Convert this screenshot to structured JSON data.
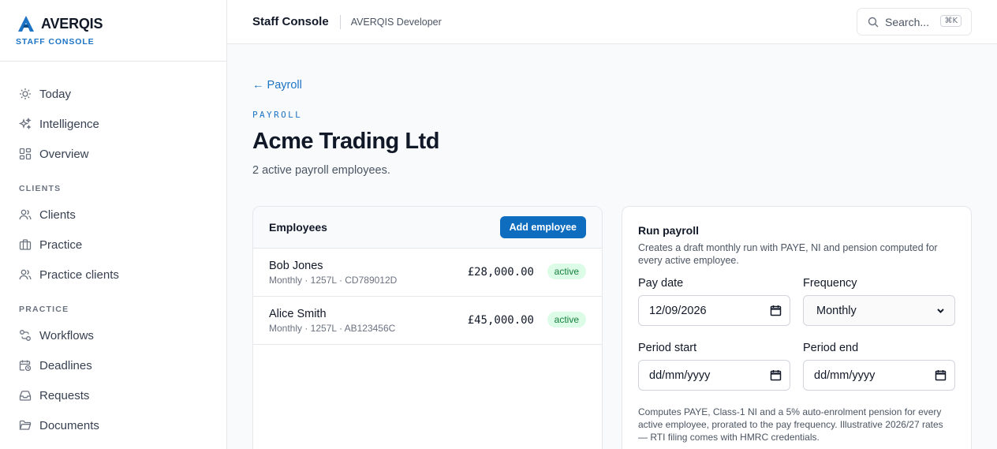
{
  "brand": {
    "name": "AVERQIS",
    "subtitle": "STAFF CONSOLE"
  },
  "sidebar": {
    "items_top": [
      {
        "label": "Today",
        "icon": "sun-icon"
      },
      {
        "label": "Intelligence",
        "icon": "sparkles-icon"
      },
      {
        "label": "Overview",
        "icon": "grid-icon"
      }
    ],
    "section_clients": "CLIENTS",
    "items_clients": [
      {
        "label": "Clients",
        "icon": "users-icon"
      },
      {
        "label": "Practice",
        "icon": "briefcase-icon"
      },
      {
        "label": "Practice clients",
        "icon": "users-icon"
      }
    ],
    "section_practice": "PRACTICE",
    "items_practice": [
      {
        "label": "Workflows",
        "icon": "workflow-icon"
      },
      {
        "label": "Deadlines",
        "icon": "calendar-clock-icon"
      },
      {
        "label": "Requests",
        "icon": "inbox-icon"
      },
      {
        "label": "Documents",
        "icon": "folder-icon"
      }
    ]
  },
  "topbar": {
    "title": "Staff Console",
    "subtitle": "AVERQIS Developer",
    "search_placeholder": "Search...",
    "search_shortcut": "⌘K"
  },
  "main": {
    "back_link": "← Payroll",
    "eyebrow": "PAYROLL",
    "title": "Acme Trading Ltd",
    "subtitle": "2 active payroll employees."
  },
  "employees": {
    "title": "Employees",
    "add_button": "Add employee",
    "rows": [
      {
        "name": "Bob Jones",
        "meta": "Monthly · 1257L · CD789012D",
        "salary": "£28,000.00",
        "status": "active"
      },
      {
        "name": "Alice Smith",
        "meta": "Monthly · 1257L · AB123456C",
        "salary": "£45,000.00",
        "status": "active"
      }
    ]
  },
  "run_payroll": {
    "title": "Run payroll",
    "description": "Creates a draft monthly run with PAYE, NI and pension computed for every active employee.",
    "pay_date_label": "Pay date",
    "pay_date_value": "12/09/2026",
    "frequency_label": "Frequency",
    "frequency_value": "Monthly",
    "period_start_label": "Period start",
    "period_start_value": "dd/mm/yyyy",
    "period_end_label": "Period end",
    "period_end_value": "dd/mm/yyyy",
    "note": "Computes PAYE, Class-1 NI and a 5% auto-enrolment pension for every active employee, prorated to the pay frequency. Illustrative 2026/27 rates — RTI filing comes with HMRC credentials."
  },
  "colors": {
    "accent": "#1d74c4",
    "primary_button": "#0f6dbf",
    "badge_bg": "#dcfce7",
    "badge_text": "#15803d"
  }
}
